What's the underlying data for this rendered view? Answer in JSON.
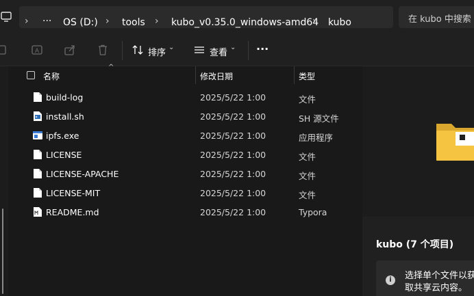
{
  "address_bar": {
    "crumbs": [
      "OS (D:)",
      "tools",
      "kubo_v0.35.0_windows-amd64",
      "kubo"
    ],
    "overflow": "···",
    "search_placeholder": "在 kubo 中搜索"
  },
  "toolbar": {
    "sort_label": "排序",
    "view_label": "查看",
    "more": "···"
  },
  "columns": {
    "name": "名称",
    "modified": "修改日期",
    "type": "类型"
  },
  "files": [
    {
      "name": "build-log",
      "date": "2025/5/22 1:00",
      "type": "文件",
      "icon": "file-icon"
    },
    {
      "name": "install.sh",
      "date": "2025/5/22 1:00",
      "type": "SH 源文件",
      "icon": "script-file-icon"
    },
    {
      "name": "ipfs.exe",
      "date": "2025/5/22 1:00",
      "type": "应用程序",
      "icon": "exe-file-icon"
    },
    {
      "name": "LICENSE",
      "date": "2025/5/22 1:00",
      "type": "文件",
      "icon": "file-icon"
    },
    {
      "name": "LICENSE-APACHE",
      "date": "2025/5/22 1:00",
      "type": "文件",
      "icon": "file-icon"
    },
    {
      "name": "LICENSE-MIT",
      "date": "2025/5/22 1:00",
      "type": "文件",
      "icon": "file-icon"
    },
    {
      "name": "README.md",
      "date": "2025/5/22 1:00",
      "type": "Typora",
      "icon": "markdown-file-icon"
    }
  ],
  "details_pane": {
    "title": "kubo (7 个项目)",
    "info": "选择单个文件以获取共享云内容。"
  },
  "colors": {
    "background": "#191919",
    "chrome": "#202020",
    "folder_yellow": "#f5c542"
  }
}
